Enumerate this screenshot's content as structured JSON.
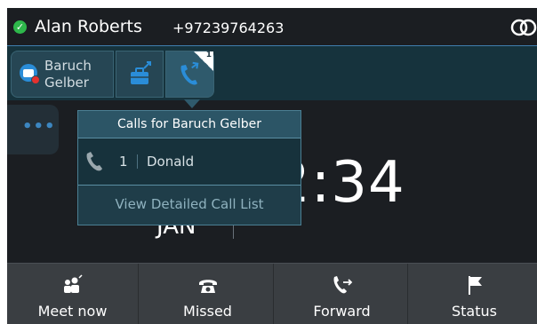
{
  "status_bar": {
    "user_name": "Alan Roberts",
    "phone_number": "+97239764263",
    "presence": "available",
    "presence_icon": "check-circle-icon",
    "brand_icon": "linked-rings-icon"
  },
  "line_keys": {
    "user_key": {
      "label_line1": "Baruch",
      "label_line2": "Gelber",
      "icon": "briefcase-user-icon"
    },
    "briefcase_key": {
      "icon": "briefcase-forward-icon"
    },
    "calls_key": {
      "icon": "phone-icon",
      "badge": "1"
    }
  },
  "more_key": {
    "dots": "•••"
  },
  "clock": {
    "time": "2:34",
    "date": "JAN"
  },
  "popup": {
    "title": "Calls for Baruch Gelber",
    "rows": [
      {
        "count": "1",
        "name": "Donald",
        "icon": "phone-icon"
      }
    ],
    "link": "View Detailed Call List"
  },
  "softkeys": [
    {
      "label": "Meet now",
      "icon": "meet-now-icon"
    },
    {
      "label": "Missed",
      "icon": "missed-call-icon"
    },
    {
      "label": "Forward",
      "icon": "forward-call-icon"
    },
    {
      "label": "Status",
      "icon": "flag-icon"
    }
  ],
  "colors": {
    "accent": "#3f7fae",
    "presence_green": "#2eb84b",
    "alert_red": "#e5312e"
  }
}
